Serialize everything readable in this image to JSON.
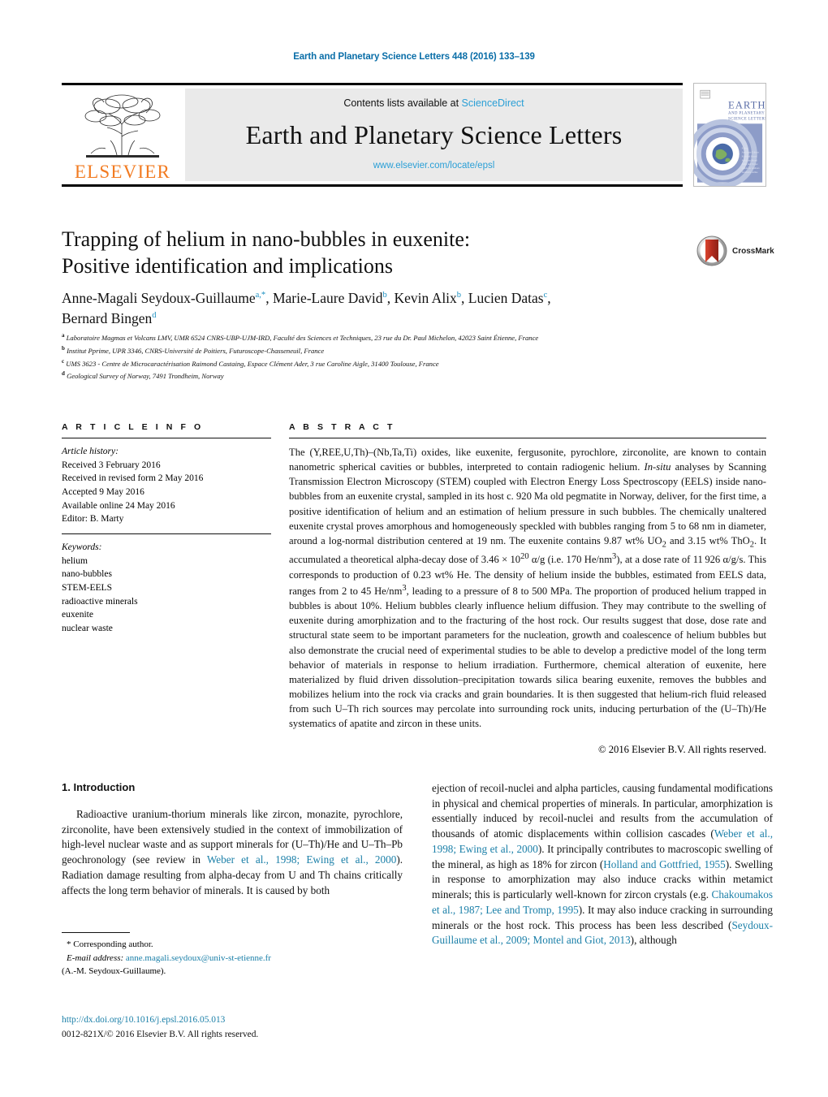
{
  "runhead": "Earth and Planetary Science Letters 448 (2016) 133–139",
  "masthead": {
    "contents_prefix": "Contents lists available at ",
    "sciencedirect": "ScienceDirect",
    "journal_title": "Earth and Planetary Science Letters",
    "journal_url": "www.elsevier.com/locate/epsl",
    "publisher": "ELSEVIER",
    "cover_title_line1": "EARTH",
    "cover_title_line2": "AND PLANETARY",
    "cover_title_line3": "SCIENCE LETTERS"
  },
  "article": {
    "title_line1": "Trapping of helium in nano-bubbles in euxenite:",
    "title_line2": "Positive identification and implications",
    "crossmark_label": "CrossMark",
    "authors_html": "Anne-Magali Seydoux-Guillaume<sup>a,*</sup>, Marie-Laure David<sup>b</sup>, Kevin Alix<sup>b</sup>, Lucien Datas<sup>c</sup>,<br>Bernard Bingen<sup>d</sup>",
    "affiliations": [
      {
        "tag": "a",
        "text": "Laboratoire Magmas et Volcans LMV, UMR 6524 CNRS-UBP-UJM-IRD, Faculté des Sciences et Techniques, 23 rue du Dr. Paul Michelon, 42023 Saint Étienne, France"
      },
      {
        "tag": "b",
        "text": "Institut Pprime, UPR 3346, CNRS-Université de Poitiers, Futuroscope-Chasseneuil, France"
      },
      {
        "tag": "c",
        "text": "UMS 3623 - Centre de Microcaractérisation Raimond Castaing, Espace Clément Ader, 3 rue Caroline Aigle, 31400 Toulouse, France"
      },
      {
        "tag": "d",
        "text": "Geological Survey of Norway, 7491 Trondheim, Norway"
      }
    ]
  },
  "article_info": {
    "heading": "A R T I C L E   I N F O",
    "history_label": "Article history:",
    "history": [
      "Received 3 February 2016",
      "Received in revised form 2 May 2016",
      "Accepted 9 May 2016",
      "Available online 24 May 2016",
      "Editor: B. Marty"
    ],
    "keywords_label": "Keywords:",
    "keywords": [
      "helium",
      "nano-bubbles",
      "STEM-EELS",
      "radioactive minerals",
      "euxenite",
      "nuclear waste"
    ]
  },
  "abstract": {
    "heading": "A B S T R A C T",
    "body_html": "The (Y,REE,U,Th)–(Nb,Ta,Ti) oxides, like euxenite, fergusonite, pyrochlore, zirconolite, are known to contain nanometric spherical cavities or bubbles, interpreted to contain radiogenic helium. <i>In-situ</i> analyses by Scanning Transmission Electron Microscopy (STEM) coupled with Electron Energy Loss Spectroscopy (EELS) inside nano-bubbles from an euxenite crystal, sampled in its host c. 920 Ma old pegmatite in Norway, deliver, for the first time, a positive identification of helium and an estimation of helium pressure in such bubbles. The chemically unaltered euxenite crystal proves amorphous and homogeneously speckled with bubbles ranging from 5 to 68 nm in diameter, around a log-normal distribution centered at 19 nm. The euxenite contains 9.87 wt% UO<sub>2</sub> and 3.15 wt% ThO<sub>2</sub>. It accumulated a theoretical alpha-decay dose of 3.46 × 10<sup>20</sup> α/g (i.e. 170 He/nm<sup>3</sup>), at a dose rate of 11 926 α/g/s. This corresponds to production of 0.23 wt% He. The density of helium inside the bubbles, estimated from EELS data, ranges from 2 to 45 He/nm<sup>3</sup>, leading to a pressure of 8 to 500 MPa. The proportion of produced helium trapped in bubbles is about 10%. Helium bubbles clearly influence helium diffusion. They may contribute to the swelling of euxenite during amorphization and to the fracturing of the host rock. Our results suggest that dose, dose rate and structural state seem to be important parameters for the nucleation, growth and coalescence of helium bubbles but also demonstrate the crucial need of experimental studies to be able to develop a predictive model of the long term behavior of materials in response to helium irradiation. Furthermore, chemical alteration of euxenite, here materialized by fluid driven dissolution–precipitation towards silica bearing euxenite, removes the bubbles and mobilizes helium into the rock via cracks and grain boundaries. It is then suggested that helium-rich fluid released from such U–Th rich sources may percolate into surrounding rock units, inducing perturbation of the (U–Th)/He systematics of apatite and zircon in these units.",
    "copyright": "© 2016 Elsevier B.V. All rights reserved."
  },
  "body": {
    "section_heading": "1. Introduction",
    "left_para_html": "Radioactive uranium-thorium minerals like zircon, monazite, pyrochlore, zirconolite, have been extensively studied in the context of immobilization of high-level nuclear waste and as support minerals for (U–Th)/He and U–Th–Pb geochronology (see review in <span class=\"ref\">Weber et al., 1998; Ewing et al., 2000</span>). Radiation damage resulting from alpha-decay from U and Th chains critically affects the long term behavior of minerals. It is caused by both",
    "right_para_html": "ejection of recoil-nuclei and alpha particles, causing fundamental modifications in physical and chemical properties of minerals. In particular, amorphization is essentially induced by recoil-nuclei and results from the accumulation of thousands of atomic displacements within collision cascades (<span class=\"ref\">Weber et al., 1998; Ewing et al., 2000</span>). It principally contributes to macroscopic swelling of the mineral, as high as 18% for zircon (<span class=\"ref\">Holland and Gottfried, 1955</span>). Swelling in response to amorphization may also induce cracks within metamict minerals; this is particularly well-known for zircon crystals (e.g. <span class=\"ref\">Chakoumakos et al., 1987; Lee and Tromp, 1995</span>). It may also induce cracking in surrounding minerals or the host rock. This process has been less described (<span class=\"ref\">Seydoux-Guillaume et al., 2009; Montel and Giot, 2013</span>), although"
  },
  "footer": {
    "corresponding_marker": "*",
    "corresponding_label": "Corresponding author.",
    "email_label": "E-mail address:",
    "email": "anne.magali.seydoux@univ-st-etienne.fr",
    "email_owner": "(A.-M. Seydoux-Guillaume).",
    "doi": "http://dx.doi.org/10.1016/j.epsl.2016.05.013",
    "issn_line": "0012-821X/© 2016 Elsevier B.V. All rights reserved."
  },
  "colors": {
    "link_blue": "#1a7fa8",
    "sciencedirect_blue": "#2a9fd6",
    "elsevier_orange": "#F27B21",
    "crossmark_red": "#b32b1e"
  }
}
